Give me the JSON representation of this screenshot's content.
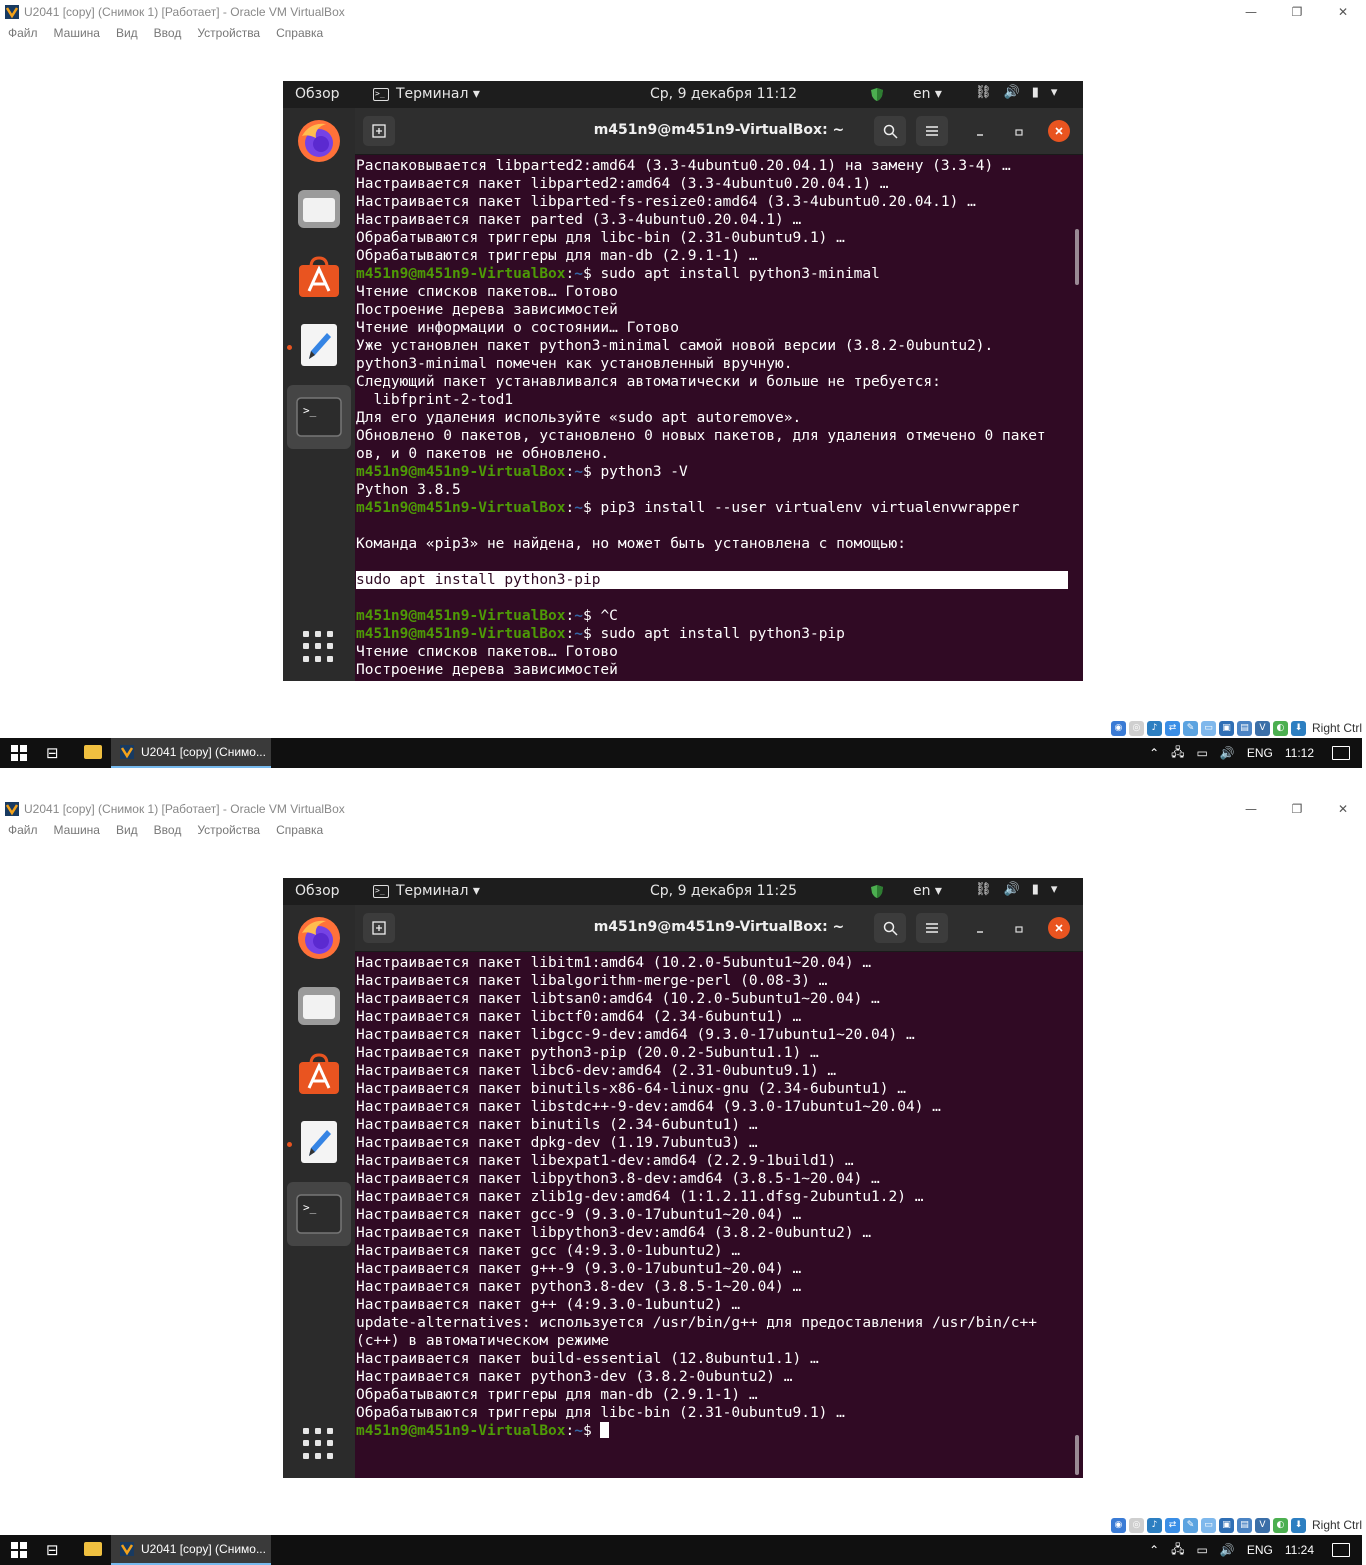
{
  "window": {
    "title": "U2041 [copy] (Снимок 1) [Работает] - Oracle VM VirtualBox",
    "controls": [
      "—",
      "❐",
      "✕"
    ]
  },
  "menu": [
    "Файл",
    "Машина",
    "Вид",
    "Ввод",
    "Устройства",
    "Справка"
  ],
  "gnome": {
    "overview": "Обзор",
    "terminal_menu": "Терминал ▾",
    "lang": "en ▾",
    "tray": [
      "⛓",
      "🔊",
      "▮",
      "▾"
    ]
  },
  "terminal": {
    "title": "m451n9@m451n9-VirtualBox: ~",
    "prompt_user": "m451n9@m451n9-VirtualBox",
    "prompt_sep": ":",
    "prompt_dir": "~",
    "prompt_end": "$ "
  },
  "status_bar": {
    "host_key": "Right Ctrl"
  },
  "taskbar": {
    "app_label": "U2041 [copy] (Снимо...",
    "lang": "ENG"
  },
  "shot1": {
    "clock": "Ср, 9 декабря  11:12",
    "taskbar_time": "11:12",
    "lines": [
      {
        "t": "Распаковывается libparted2:amd64 (3.3-4ubuntu0.20.04.1) на замену (3.3-4) …"
      },
      {
        "t": "Настраивается пакет libparted2:amd64 (3.3-4ubuntu0.20.04.1) …"
      },
      {
        "t": "Настраивается пакет libparted-fs-resize0:amd64 (3.3-4ubuntu0.20.04.1) …"
      },
      {
        "t": "Настраивается пакет parted (3.3-4ubuntu0.20.04.1) …"
      },
      {
        "t": "Обрабатываются триггеры для libc-bin (2.31-0ubuntu9.1) …"
      },
      {
        "t": "Обрабатываются триггеры для man-db (2.9.1-1) …"
      },
      {
        "p": true,
        "t": "sudo apt install python3-minimal"
      },
      {
        "t": "Чтение списков пакетов… Готово"
      },
      {
        "t": "Построение дерева зависимостей"
      },
      {
        "t": "Чтение информации о состоянии… Готово"
      },
      {
        "t": "Уже установлен пакет python3-minimal самой новой версии (3.8.2-0ubuntu2)."
      },
      {
        "t": "python3-minimal помечен как установленный вручную."
      },
      {
        "t": "Следующий пакет устанавливался автоматически и больше не требуется:"
      },
      {
        "t": "  libfprint-2-tod1"
      },
      {
        "t": "Для его удаления используйте «sudo apt autoremove»."
      },
      {
        "t": "Обновлено 0 пакетов, установлено 0 новых пакетов, для удаления отмечено 0 пакет"
      },
      {
        "t": "ов, и 0 пакетов не обновлено."
      },
      {
        "p": true,
        "t": "python3 -V"
      },
      {
        "t": "Python 3.8.5"
      },
      {
        "p": true,
        "t": "pip3 install --user virtualenv virtualenvwrapper"
      },
      {
        "t": ""
      },
      {
        "t": "Команда «pip3» не найдена, но может быть установлена с помощью:"
      },
      {
        "t": ""
      },
      {
        "hl": true,
        "t": "sudo apt install python3-pip"
      },
      {
        "t": ""
      },
      {
        "p": true,
        "t": "^C"
      },
      {
        "p": true,
        "t": "sudo apt install python3-pip"
      },
      {
        "t": "Чтение списков пакетов… Готово"
      },
      {
        "t": "Построение дерева зависимостей"
      }
    ]
  },
  "shot2": {
    "clock": "Ср, 9 декабря  11:25",
    "taskbar_time": "11:24",
    "lines": [
      {
        "t": "Настраивается пакет libitm1:amd64 (10.2.0-5ubuntu1~20.04) …"
      },
      {
        "t": "Настраивается пакет libalgorithm-merge-perl (0.08-3) …"
      },
      {
        "t": "Настраивается пакет libtsan0:amd64 (10.2.0-5ubuntu1~20.04) …"
      },
      {
        "t": "Настраивается пакет libctf0:amd64 (2.34-6ubuntu1) …"
      },
      {
        "t": "Настраивается пакет libgcc-9-dev:amd64 (9.3.0-17ubuntu1~20.04) …"
      },
      {
        "t": "Настраивается пакет python3-pip (20.0.2-5ubuntu1.1) …"
      },
      {
        "t": "Настраивается пакет libc6-dev:amd64 (2.31-0ubuntu9.1) …"
      },
      {
        "t": "Настраивается пакет binutils-x86-64-linux-gnu (2.34-6ubuntu1) …"
      },
      {
        "t": "Настраивается пакет libstdc++-9-dev:amd64 (9.3.0-17ubuntu1~20.04) …"
      },
      {
        "t": "Настраивается пакет binutils (2.34-6ubuntu1) …"
      },
      {
        "t": "Настраивается пакет dpkg-dev (1.19.7ubuntu3) …"
      },
      {
        "t": "Настраивается пакет libexpat1-dev:amd64 (2.2.9-1build1) …"
      },
      {
        "t": "Настраивается пакет libpython3.8-dev:amd64 (3.8.5-1~20.04) …"
      },
      {
        "t": "Настраивается пакет zlib1g-dev:amd64 (1:1.2.11.dfsg-2ubuntu1.2) …"
      },
      {
        "t": "Настраивается пакет gcc-9 (9.3.0-17ubuntu1~20.04) …"
      },
      {
        "t": "Настраивается пакет libpython3-dev:amd64 (3.8.2-0ubuntu2) …"
      },
      {
        "t": "Настраивается пакет gcc (4:9.3.0-1ubuntu2) …"
      },
      {
        "t": "Настраивается пакет g++-9 (9.3.0-17ubuntu1~20.04) …"
      },
      {
        "t": "Настраивается пакет python3.8-dev (3.8.5-1~20.04) …"
      },
      {
        "t": "Настраивается пакет g++ (4:9.3.0-1ubuntu2) …"
      },
      {
        "t": "update-alternatives: используется /usr/bin/g++ для предоставления /usr/bin/c++"
      },
      {
        "t": "(c++) в автоматическом режиме"
      },
      {
        "t": "Настраивается пакет build-essential (12.8ubuntu1.1) …"
      },
      {
        "t": "Настраивается пакет python3-dev (3.8.2-0ubuntu2) …"
      },
      {
        "t": "Обрабатываются триггеры для man-db (2.9.1-1) …"
      },
      {
        "t": "Обрабатываются триггеры для libc-bin (2.31-0ubuntu9.1) …"
      },
      {
        "p": true,
        "cursor": true,
        "t": ""
      }
    ]
  }
}
